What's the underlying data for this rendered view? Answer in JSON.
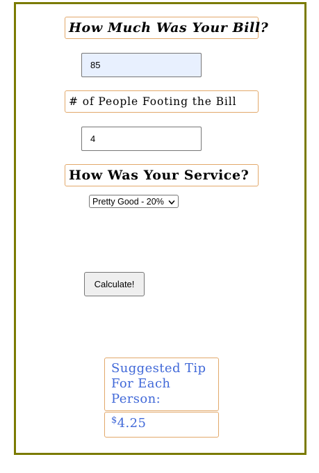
{
  "bill": {
    "label": "How Much Was Your Bill?",
    "value": "85"
  },
  "people": {
    "label": "# of People Footing the Bill",
    "value": "4"
  },
  "service": {
    "label": "How Was Your Service?",
    "selected": "Pretty Good - 20%"
  },
  "calculate_label": "Calculate!",
  "result": {
    "title": "Suggested Tip For Each Person:",
    "currency": "$",
    "amount": "4.25"
  },
  "colors": {
    "frame_border": "#7b7b00",
    "label_border": "#e2a86a",
    "result_text": "#4169d8",
    "autofill_bg": "#e8f0fe"
  }
}
